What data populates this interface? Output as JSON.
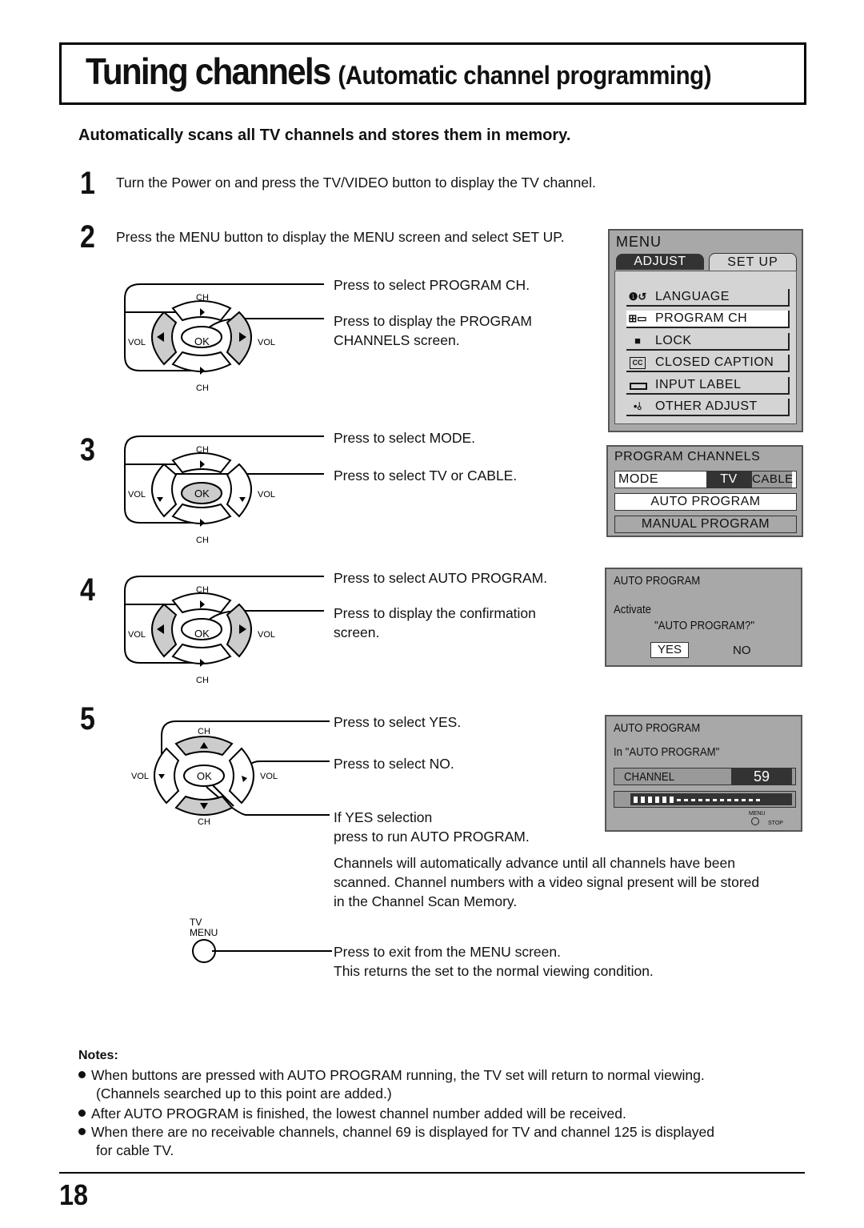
{
  "header": {
    "title_main": "Tuning channels",
    "title_sub": "(Automatic channel programming)",
    "subtitle": "Automatically scans all TV channels and stores them in memory."
  },
  "steps": [
    {
      "number": "1",
      "text": "Turn the Power on and press the TV/VIDEO button to display the TV channel."
    },
    {
      "number": "2",
      "text": "Press the MENU button to display the MENU screen and select SET UP.",
      "callouts": [
        "Press to select PROGRAM CH.",
        "Press to display the PROGRAM",
        "CHANNELS screen."
      ]
    },
    {
      "number": "3",
      "callouts": [
        "Press to select MODE.",
        "Press to select TV or CABLE."
      ]
    },
    {
      "number": "4",
      "callouts": [
        "Press to select AUTO PROGRAM.",
        "Press to display the confirmation",
        "screen."
      ]
    },
    {
      "number": "5",
      "callouts": [
        "Press to select YES.",
        "Press to select NO.",
        "If YES selection",
        "press to run AUTO PROGRAM."
      ],
      "after_text": [
        "Channels will automatically advance until all channels have been",
        "scanned. Channel numbers with a video signal present will be stored",
        "in the Channel Scan Memory."
      ],
      "menu_callouts": [
        "Press to exit from the MENU screen.",
        "This returns the set to the normal viewing condition."
      ]
    }
  ],
  "remote": {
    "ch_label": "CH",
    "vol_label": "VOL",
    "ok_label": "OK",
    "tv_menu_line1": "TV",
    "tv_menu_line2": "MENU"
  },
  "menu_osd": {
    "title": "MENU",
    "tabs": [
      {
        "label": "ADJUST",
        "active": false
      },
      {
        "label": "SET  UP",
        "active": true
      }
    ],
    "items": [
      {
        "icon": "language-icon",
        "glyph": "❶⟲",
        "label": "LANGUAGE",
        "selected": false
      },
      {
        "icon": "program-ch-icon",
        "glyph": "⊞",
        "label": "PROGRAM  CH",
        "selected": true
      },
      {
        "icon": "lock-icon",
        "glyph": "🔒",
        "label": "LOCK",
        "selected": false
      },
      {
        "icon": "cc-icon",
        "glyph": "CC",
        "label": "CLOSED  CAPTION",
        "selected": false
      },
      {
        "icon": "input-label-icon",
        "glyph": "▭",
        "label": "INPUT  LABEL",
        "selected": false
      },
      {
        "icon": "other-adjust-icon",
        "glyph": "⁎",
        "label": "OTHER  ADJUST",
        "selected": false
      }
    ]
  },
  "program_osd": {
    "title": "PROGRAM  CHANNELS",
    "mode_label": "MODE",
    "mode_options": [
      "TV",
      "CABLE"
    ],
    "mode_selected": "TV",
    "auto_program": "AUTO  PROGRAM",
    "manual_program": "MANUAL  PROGRAM"
  },
  "confirm_osd": {
    "title": "AUTO  PROGRAM",
    "line1": "Activate",
    "line2": "\"AUTO  PROGRAM?\"",
    "yes": "YES",
    "no": "NO",
    "selected": "YES"
  },
  "progress_osd": {
    "title": "AUTO  PROGRAM",
    "status": "In \"AUTO  PROGRAM\"",
    "channel_label": "CHANNEL",
    "channel_value": "59",
    "progress_filled_segments": 6,
    "progress_total_segments": 18,
    "stop_hint_button": "MENU",
    "stop_hint_label": "STOP"
  },
  "notes": {
    "title": "Notes:",
    "items": [
      {
        "lines": [
          "When buttons are pressed with AUTO PROGRAM running, the TV set will return to normal viewing.",
          "(Channels searched up to this point are added.)"
        ]
      },
      {
        "lines": [
          "After AUTO PROGRAM is finished, the lowest channel number added will be received."
        ]
      },
      {
        "lines": [
          "When there are no receivable channels, channel 69 is displayed for TV and channel 125 is displayed",
          "for cable TV."
        ]
      }
    ]
  },
  "footer": {
    "page_number": "18"
  }
}
